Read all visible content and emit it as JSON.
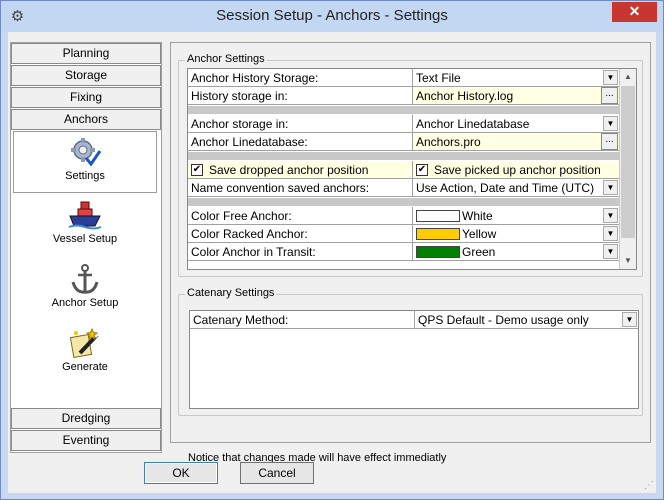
{
  "window": {
    "title": "Session Setup - Anchors -  Settings",
    "close_label": "✕"
  },
  "nav": {
    "top_tabs": [
      "Planning",
      "Storage",
      "Fixing",
      "Anchors"
    ],
    "items": [
      {
        "label": "Settings",
        "icon": "gear-check-icon"
      },
      {
        "label": "Vessel Setup",
        "icon": "vessel-icon"
      },
      {
        "label": "Anchor Setup",
        "icon": "anchor-icon"
      },
      {
        "label": "Generate",
        "icon": "generate-icon"
      }
    ],
    "bottom_tabs": [
      "Dredging",
      "Eventing"
    ]
  },
  "anchor_settings": {
    "legend": "Anchor Settings",
    "rows": {
      "history_storage": {
        "label": "Anchor History Storage:",
        "value": "Text File"
      },
      "history_in": {
        "label": "History storage in:",
        "value": "Anchor History.log"
      },
      "storage_in": {
        "label": "Anchor storage in:",
        "value": "Anchor Linedatabase"
      },
      "linedatabase": {
        "label": "Anchor Linedatabase:",
        "value": "Anchors.pro"
      },
      "save_dropped": {
        "label": "Save dropped anchor position",
        "checked": true
      },
      "save_picked": {
        "label": "Save picked up anchor position",
        "checked": true
      },
      "name_convention": {
        "label": "Name convention saved anchors:",
        "value": "Use Action, Date and Time (UTC)"
      },
      "color_free": {
        "label": "Color Free Anchor:",
        "value": "White",
        "color": "#ffffff"
      },
      "color_racked": {
        "label": "Color Racked Anchor:",
        "value": "Yellow",
        "color": "#ffcc00"
      },
      "color_transit": {
        "label": "Color Anchor in Transit:",
        "value": "Green",
        "color": "#008000"
      }
    }
  },
  "catenary_settings": {
    "legend": "Catenary Settings",
    "method_label": "Catenary Method:",
    "method_value": "QPS Default - Demo usage only"
  },
  "notice": "Notice that changes made will have effect immediatly",
  "buttons": {
    "ok": "OK",
    "cancel": "Cancel"
  },
  "symbols": {
    "dropdown": "▼",
    "ellipsis": "...",
    "check": "✔",
    "scroll_up": "▲",
    "scroll_down": "▼"
  }
}
